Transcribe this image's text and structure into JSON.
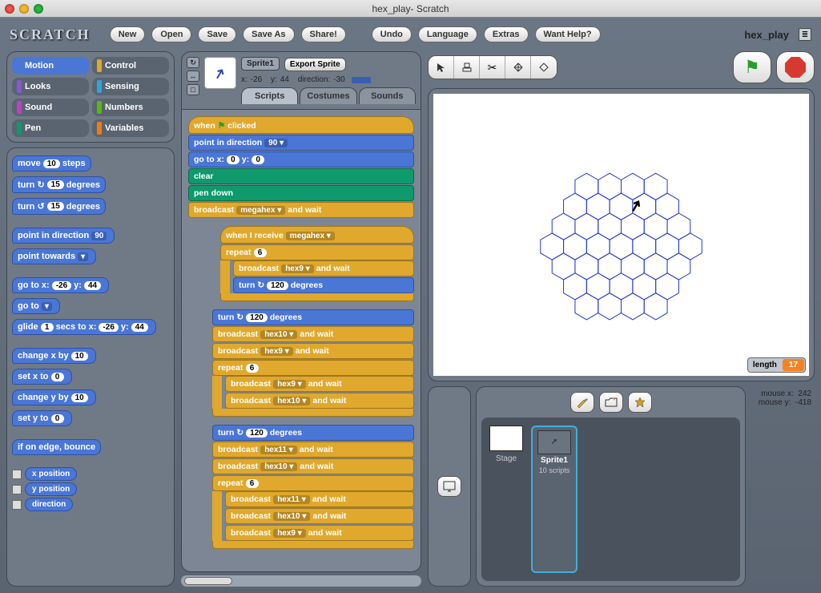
{
  "window": {
    "title": "hex_play- Scratch"
  },
  "topbar": {
    "logo": "SCRATCH",
    "new": "New",
    "open": "Open",
    "save": "Save",
    "saveas": "Save As",
    "share": "Share!",
    "undo": "Undo",
    "language": "Language",
    "extras": "Extras",
    "help": "Want Help?",
    "project": "hex_play"
  },
  "categories": [
    {
      "name": "Motion",
      "color": "#4a76d6",
      "sel": true
    },
    {
      "name": "Control",
      "color": "#e0a82c"
    },
    {
      "name": "Looks",
      "color": "#8a55d7"
    },
    {
      "name": "Sensing",
      "color": "#2ca5e2"
    },
    {
      "name": "Sound",
      "color": "#bb42c3"
    },
    {
      "name": "Numbers",
      "color": "#5cb712"
    },
    {
      "name": "Pen",
      "color": "#0e9a6c"
    },
    {
      "name": "Variables",
      "color": "#ee7d16"
    }
  ],
  "palette": {
    "move_steps": "move",
    "steps_val": "10",
    "steps_suf": "steps",
    "turn_cw": "turn ↻",
    "turn_ccw": "turn ↺",
    "turn_val": "15",
    "degrees": "degrees",
    "point_dir": "point in direction",
    "dir_val": "90",
    "point_towards": "point towards",
    "goto_xy": "go to x:",
    "x_val": "-26",
    "y_lbl": "y:",
    "y_val": "44",
    "goto": "go to",
    "glide": "glide",
    "secs_val": "1",
    "secs_to_x": "secs to x:",
    "gx": "-26",
    "gy": "44",
    "change_x": "change x by",
    "cx": "10",
    "set_x": "set x to",
    "sx": "0",
    "change_y": "change y by",
    "cy": "10",
    "set_y": "set y to",
    "sy": "0",
    "if_edge": "if on edge, bounce",
    "xpos": "x position",
    "ypos": "y position",
    "dir": "direction"
  },
  "sprite": {
    "name": "Sprite1",
    "export": "Export Sprite",
    "x_lbl": "x:",
    "x": "-26",
    "y_lbl": "y:",
    "y": "44",
    "dir_lbl": "direction:",
    "dir": "-30",
    "scripts_count": "10 scripts"
  },
  "tabs": {
    "scripts": "Scripts",
    "costumes": "Costumes",
    "sounds": "Sounds"
  },
  "scripts": {
    "when_clicked": "when",
    "clicked_suf": "clicked",
    "point_dir": "point in direction",
    "v90": "90",
    "goto": "go to x:",
    "gx": "0",
    "gyl": "y:",
    "gy": "0",
    "clear": "clear",
    "pen_down": "pen down",
    "broadcast": "broadcast",
    "and_wait": "and wait",
    "megahex": "megahex",
    "hex9": "hex9",
    "hex10": "hex10",
    "hex11": "hex11",
    "when_receive": "when I receive",
    "repeat": "repeat",
    "r6": "6",
    "turn": "turn ↻",
    "d120": "120",
    "deg": "degrees"
  },
  "stage": {
    "tools": {
      "pointer": "▶",
      "stamp": "⌸",
      "scissors": "✂",
      "grow": "⤢",
      "shrink": "⤡"
    },
    "var_name": "length",
    "var_val": "17",
    "mouse_x_lbl": "mouse x:",
    "mouse_x": "242",
    "mouse_y_lbl": "mouse y:",
    "mouse_y": "-418",
    "stage_lbl": "Stage"
  },
  "new_sprite": {
    "paint": "✎",
    "file": "📂",
    "random": "★"
  },
  "proj_menu_icon": "≣"
}
